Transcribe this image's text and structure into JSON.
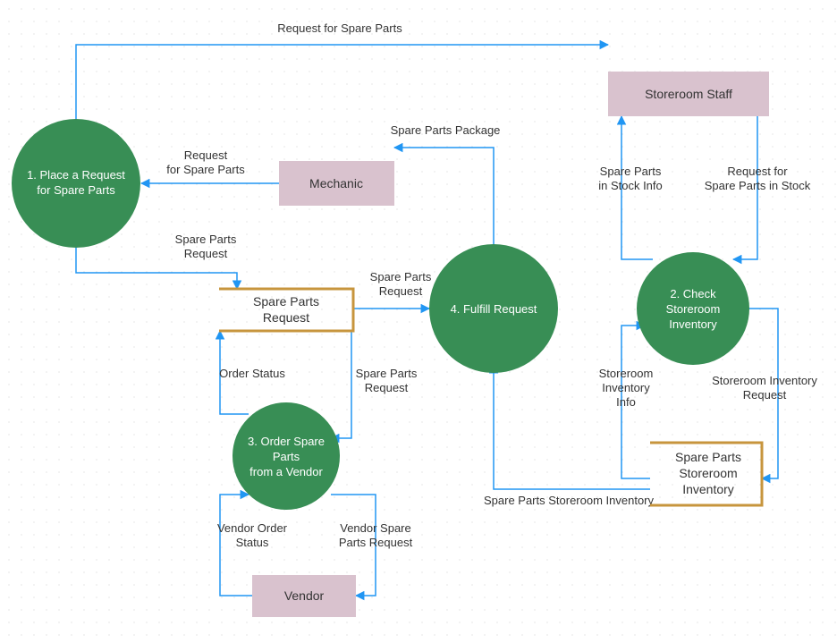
{
  "processes": {
    "p1": {
      "l1": "1. Place a Request",
      "l2": "for Spare Parts"
    },
    "p2": {
      "l1": "2. Check",
      "l2": "Storeroom",
      "l3": "Inventory"
    },
    "p3": {
      "l1": "3. Order Spare",
      "l2": "Parts",
      "l3": "from a Vendor"
    },
    "p4": {
      "l1": "4. Fulfill Request"
    }
  },
  "entities": {
    "mechanic": "Mechanic",
    "vendor": "Vendor",
    "storeroom_staff": "Storeroom Staff"
  },
  "stores": {
    "spare_parts_request": {
      "l1": "Spare Parts",
      "l2": "Request"
    },
    "storeroom_inventory": {
      "l1": "Spare Parts",
      "l2": "Storeroom",
      "l3": "Inventory"
    }
  },
  "flows": {
    "f1": "Request for Spare Parts",
    "f2a": "Request",
    "f2b": "for Spare Parts",
    "f3": "Spare Parts Package",
    "f4a": "Spare Parts",
    "f4b": "Request",
    "f5a": "Spare Parts",
    "f5b": "Request",
    "f6": "Order  Status",
    "f7a": "Spare Parts",
    "f7b": "Request",
    "f8a": "Vendor Order",
    "f8b": "Status",
    "f9a": "Vendor Spare",
    "f9b": "Parts Request",
    "f10a": "Spare Parts",
    "f10b": "in Stock Info",
    "f11a": "Request for",
    "f11b": "Spare Parts in Stock",
    "f12a": "Storeroom",
    "f12b": "Inventory",
    "f12c": "Info",
    "f13a": "Storeroom Inventory",
    "f13b": "Request",
    "f14": "Spare Parts Storeroom Inventory"
  }
}
